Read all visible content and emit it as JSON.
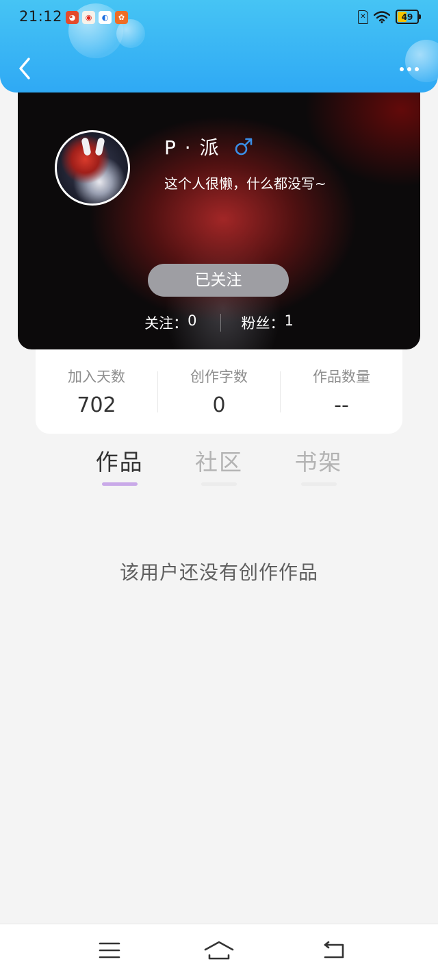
{
  "status_bar": {
    "time": "21:12",
    "notifications": [
      {
        "icon": "app-notification-icon",
        "glyph": "◕"
      },
      {
        "icon": "weibo-icon",
        "glyph": "◉"
      },
      {
        "icon": "qq-browser-icon",
        "glyph": "◐"
      },
      {
        "icon": "app-notification-icon-2",
        "glyph": "✿"
      }
    ],
    "sim_label": "✕",
    "battery": "49",
    "battery_level": 0.49
  },
  "nav": {
    "back_icon": "chevron-left-icon",
    "more_icon": "more-dots-icon"
  },
  "profile": {
    "nickname": "P · 派",
    "gender_icon": "male-icon",
    "gender_color": "#3a8ee6",
    "signature": "这个人很懒，什么都没写~",
    "follow_button_label": "已关注",
    "following_label": "关注：",
    "following_count": "0",
    "fans_label": "粉丝：",
    "fans_count": "1"
  },
  "stats": [
    {
      "label": "加入天数",
      "value": "702"
    },
    {
      "label": "创作字数",
      "value": "0"
    },
    {
      "label": "作品数量",
      "value": "--"
    }
  ],
  "tabs": [
    {
      "label": "作品",
      "active": true
    },
    {
      "label": "社区",
      "active": false
    },
    {
      "label": "书架",
      "active": false
    }
  ],
  "empty_state": "该用户还没有创作作品",
  "bottom_nav": {
    "icons": [
      "menu-icon",
      "home-icon",
      "back-icon"
    ]
  },
  "colors": {
    "header_top": "#46c4f4",
    "header_bottom": "#2fa9f4",
    "tab_active_indicator": "#c9a9e8",
    "follow_button_bg": "#9e9ea3"
  }
}
